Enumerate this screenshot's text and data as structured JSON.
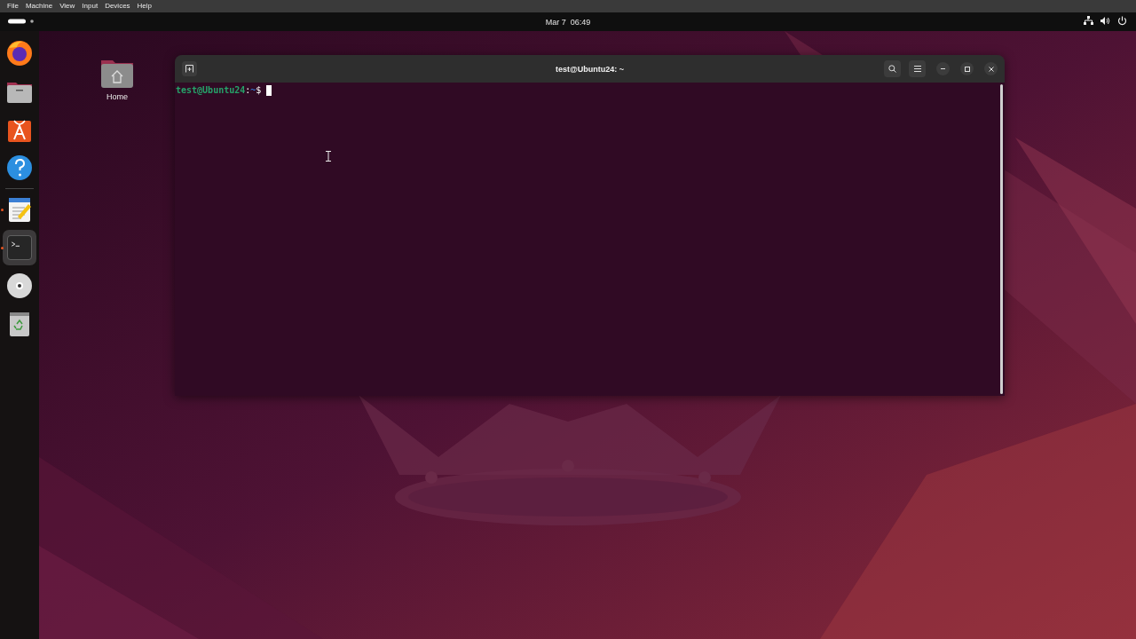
{
  "menubar": {
    "items": [
      "File",
      "Machine",
      "View",
      "Input",
      "Devices",
      "Help"
    ]
  },
  "topbar": {
    "clock": "Mar 7  06:49"
  },
  "dock": {
    "apps": [
      {
        "kind": "browser",
        "running": false,
        "selected": false
      },
      {
        "kind": "files",
        "running": false,
        "selected": false
      },
      {
        "kind": "software",
        "running": false,
        "selected": false
      },
      {
        "kind": "help",
        "running": false,
        "selected": false
      },
      {
        "kind": "text-editor",
        "running": true,
        "selected": false
      },
      {
        "kind": "terminal",
        "running": true,
        "selected": true
      },
      {
        "kind": "disc",
        "running": false,
        "selected": false
      },
      {
        "kind": "trash",
        "running": false,
        "selected": false
      }
    ]
  },
  "desktop": {
    "icons": [
      {
        "label": "Home"
      }
    ]
  },
  "terminal": {
    "title": "test@Ubuntu24: ~",
    "prompt": [
      {
        "kind": "user_host",
        "text": "test@Ubuntu24"
      },
      {
        "kind": "separator",
        "text": ":"
      },
      {
        "kind": "path",
        "text": "~"
      },
      {
        "kind": "symbol",
        "text": "$"
      }
    ]
  }
}
